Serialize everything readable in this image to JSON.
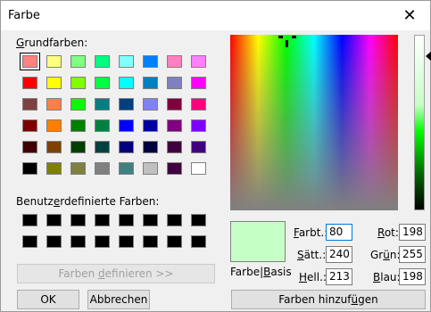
{
  "window": {
    "title": "Farbe",
    "close_glyph": "✕"
  },
  "basic_colors": {
    "label_pre": "",
    "label_u": "G",
    "label_post": "rundfarben:",
    "rows": [
      [
        "#ff8080",
        "#ffff80",
        "#80ff80",
        "#00ff80",
        "#80ffff",
        "#0080ff",
        "#ff80c0",
        "#ff80ff"
      ],
      [
        "#ff0000",
        "#ffff00",
        "#80ff00",
        "#00ff40",
        "#00ffff",
        "#0080c0",
        "#8080c0",
        "#ff00ff"
      ],
      [
        "#804040",
        "#ff8040",
        "#00ff00",
        "#008080",
        "#004080",
        "#8080ff",
        "#800040",
        "#ff0080"
      ],
      [
        "#800000",
        "#ff8000",
        "#008000",
        "#008040",
        "#0000ff",
        "#0000a0",
        "#800080",
        "#8000ff"
      ],
      [
        "#400000",
        "#804000",
        "#004000",
        "#004040",
        "#000080",
        "#000040",
        "#400040",
        "#400080"
      ],
      [
        "#000000",
        "#808000",
        "#808040",
        "#808080",
        "#408080",
        "#c0c0c0",
        "#400040",
        "#ffffff"
      ]
    ]
  },
  "custom_colors": {
    "label_pre": "Benutz",
    "label_u": "e",
    "label_post": "rdefinierte Farben:",
    "count": 16
  },
  "buttons": {
    "define_pre": "Farben ",
    "define_u": "d",
    "define_post": "efinieren >>",
    "ok": "OK",
    "cancel": "Abbrechen",
    "add_pre": "Farben hinzuf",
    "add_u": "ü",
    "add_post": "gen"
  },
  "preview": {
    "label_pre": "Farbe|",
    "label_u": "B",
    "label_post": "asis"
  },
  "fields": {
    "hue": {
      "pre": "",
      "u": "F",
      "post": "arbt.:",
      "value": "80"
    },
    "sat": {
      "pre": "",
      "u": "S",
      "post": "ätt.:",
      "value": "240"
    },
    "lum": {
      "pre": "",
      "u": "H",
      "post": "ell.:",
      "value": "213"
    },
    "red": {
      "pre": "",
      "u": "R",
      "post": "ot:",
      "value": "198"
    },
    "green": {
      "pre": "Gr",
      "u": "ü",
      "post": "n:",
      "value": "255"
    },
    "blue": {
      "pre": "",
      "u": "B",
      "post": "lau:",
      "value": "198"
    }
  },
  "colors": {
    "current": "#c6ffc6",
    "focus_border": "#0078d7"
  },
  "icons": {
    "close": "close-icon",
    "crosshair": "crosshair-icon",
    "luminance_arrow": "arrow-left-icon"
  }
}
